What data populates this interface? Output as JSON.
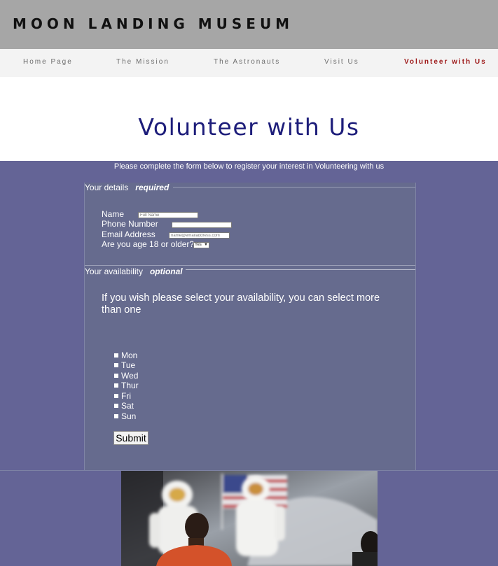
{
  "site": {
    "title": "MOON LANDING MUSEUM"
  },
  "nav": {
    "items": [
      {
        "label": "Home Page"
      },
      {
        "label": "The Mission"
      },
      {
        "label": "The Astronauts"
      },
      {
        "label": "Visit Us"
      },
      {
        "label": "Volunteer with Us",
        "active": true
      }
    ]
  },
  "page": {
    "title": "Volunteer with Us",
    "intro": "Please complete the form below to register your interest in Volunteering with us"
  },
  "form": {
    "details": {
      "legend": "Your details",
      "tag": "required",
      "name_label": "Name",
      "name_placeholder": "Full Name",
      "phone_label": "Phone Number",
      "phone_placeholder": "",
      "email_label": "Email Address",
      "email_placeholder": "name@emailaddress.com",
      "age_label": "Are you age 18 or older?",
      "age_value": "Yes"
    },
    "availability": {
      "legend": "Your availability",
      "tag": "optional",
      "text": "If you wish please select your availability, you can select more than one",
      "days": [
        "Mon",
        "Tue",
        "Wed",
        "Thur",
        "Fri",
        "Sat",
        "Sun"
      ]
    },
    "submit_label": "Submit"
  },
  "colors": {
    "header_bg": "#a6a6a6",
    "nav_bg": "#f3f3f3",
    "nav_active": "#9c1616",
    "title": "#1d1d7a",
    "page_bg": "#646496",
    "form_bg": "#666b8e"
  },
  "image": {
    "subject": "astronaut-exhibit-photo"
  }
}
